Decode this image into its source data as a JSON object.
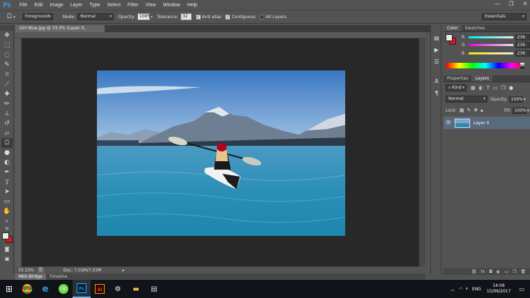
{
  "menubar": {
    "logo": "Ps",
    "items": [
      "File",
      "Edit",
      "Image",
      "Layer",
      "Type",
      "Select",
      "Filter",
      "View",
      "Window",
      "Help"
    ],
    "controls": [
      "—",
      "❐",
      "✕"
    ]
  },
  "options": {
    "source": "Foreground",
    "mode_label": "Mode:",
    "mode_value": "Normal",
    "opacity_label": "Opacity:",
    "opacity_value": "100%",
    "tolerance_label": "Tolerance:",
    "tolerance_value": "32",
    "antialias_label": "Anti-alias",
    "contiguous_label": "Contiguous",
    "alllayers_label": "All Layers",
    "workspace": "Essentials"
  },
  "document": {
    "tab_title": "Girl Blue.jpg @ 33.3% (Layer 0, RGB/8#) *",
    "tab_close": "✕",
    "zoom": "33.33%",
    "doc_info": "Doc: 7.03M/7.03M"
  },
  "bottom_tabs": [
    "Mini Bridge",
    "Timeline"
  ],
  "color_panel": {
    "tabs": [
      "Color",
      "Swatches"
    ],
    "r_label": "R",
    "r_value": "236",
    "g_label": "G",
    "g_value": "236",
    "b_label": "B",
    "b_value": "236"
  },
  "layers_panel": {
    "tabs": [
      "Properties",
      "Layers"
    ],
    "kind_label": "Kind",
    "blend_mode": "Normal",
    "opacity_label": "Opacity:",
    "opacity_value": "100%",
    "lock_label": "Lock:",
    "fill_label": "Fill:",
    "fill_value": "100%",
    "layer_name": "Layer 0"
  },
  "taskbar": {
    "language": "ENG",
    "time": "14:06",
    "date": "15/06/2017"
  },
  "colors": {
    "foreground": "#ececec",
    "background": "#e0141e",
    "accent": "#31a8ff"
  }
}
